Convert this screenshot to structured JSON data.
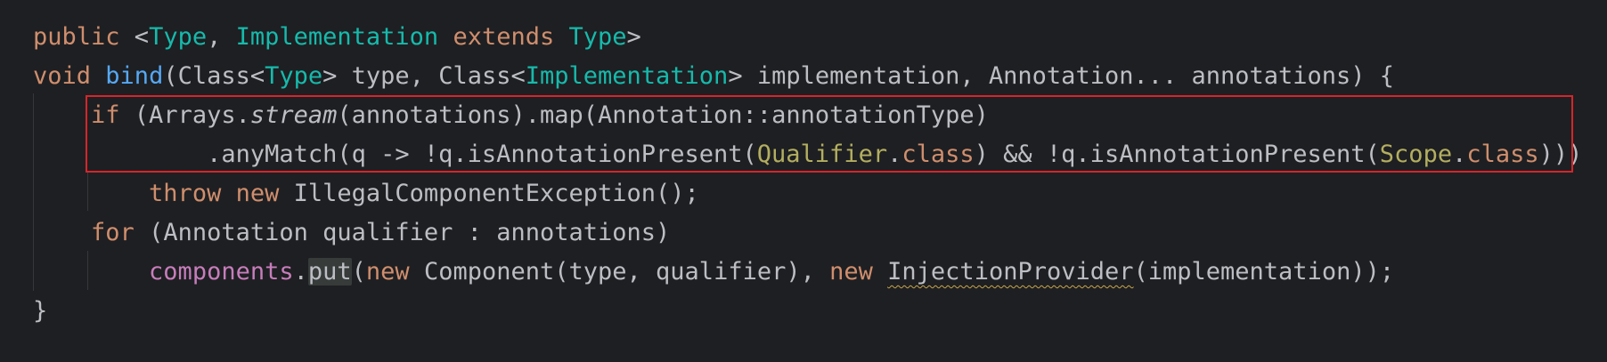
{
  "editor": {
    "language": "Java",
    "highlight_box_color": "#d6252b",
    "lines": [
      {
        "tokens": [
          {
            "t": "public",
            "c": "kw"
          },
          {
            "t": " <",
            "c": ""
          },
          {
            "t": "Type",
            "c": "tp"
          },
          {
            "t": ", ",
            "c": ""
          },
          {
            "t": "Implementation",
            "c": "tp"
          },
          {
            "t": " ",
            "c": ""
          },
          {
            "t": "extends",
            "c": "kw"
          },
          {
            "t": " ",
            "c": ""
          },
          {
            "t": "Type",
            "c": "tp"
          },
          {
            "t": ">",
            "c": ""
          }
        ]
      },
      {
        "tokens": [
          {
            "t": "void",
            "c": "kw"
          },
          {
            "t": " ",
            "c": ""
          },
          {
            "t": "bind",
            "c": "fn"
          },
          {
            "t": "(Class<",
            "c": ""
          },
          {
            "t": "Type",
            "c": "tp"
          },
          {
            "t": "> type, Class<",
            "c": ""
          },
          {
            "t": "Implementation",
            "c": "tp"
          },
          {
            "t": "> implementation, Annotation... annotations) {",
            "c": ""
          }
        ]
      },
      {
        "tokens": [
          {
            "t": "    ",
            "c": ""
          },
          {
            "t": "if",
            "c": "kw"
          },
          {
            "t": " (Arrays.",
            "c": ""
          },
          {
            "t": "stream",
            "c": "st"
          },
          {
            "t": "(annotations).map(Annotation::annotationType)",
            "c": ""
          }
        ]
      },
      {
        "tokens": [
          {
            "t": "            .anyMatch(q -> !q.isAnnotationPresent(",
            "c": ""
          },
          {
            "t": "Qualifier",
            "c": "an"
          },
          {
            "t": ".",
            "c": ""
          },
          {
            "t": "class",
            "c": "kw"
          },
          {
            "t": ") && !q.isAnnotationPresent(",
            "c": ""
          },
          {
            "t": "Scope",
            "c": "an"
          },
          {
            "t": ".",
            "c": ""
          },
          {
            "t": "class",
            "c": "kw"
          },
          {
            "t": ")))",
            "c": ""
          }
        ]
      },
      {
        "tokens": [
          {
            "t": "        ",
            "c": ""
          },
          {
            "t": "throw",
            "c": "kw"
          },
          {
            "t": " ",
            "c": ""
          },
          {
            "t": "new",
            "c": "kw"
          },
          {
            "t": " IllegalComponentException();",
            "c": ""
          }
        ]
      },
      {
        "tokens": [
          {
            "t": "    ",
            "c": ""
          },
          {
            "t": "for",
            "c": "kw"
          },
          {
            "t": " (Annotation qualifier : annotations)",
            "c": ""
          }
        ]
      },
      {
        "tokens": [
          {
            "t": "        ",
            "c": ""
          },
          {
            "t": "components",
            "c": "pu"
          },
          {
            "t": ".",
            "c": ""
          },
          {
            "t": "put",
            "c": "hl"
          },
          {
            "t": "(",
            "c": ""
          },
          {
            "t": "new",
            "c": "kw"
          },
          {
            "t": " Component(type, qualifier), ",
            "c": ""
          },
          {
            "t": "new",
            "c": "kw"
          },
          {
            "t": " ",
            "c": ""
          },
          {
            "t": "InjectionProvider",
            "c": "squig"
          },
          {
            "t": "(implementation));",
            "c": ""
          }
        ]
      },
      {
        "tokens": [
          {
            "t": "}",
            "c": ""
          }
        ]
      }
    ]
  }
}
